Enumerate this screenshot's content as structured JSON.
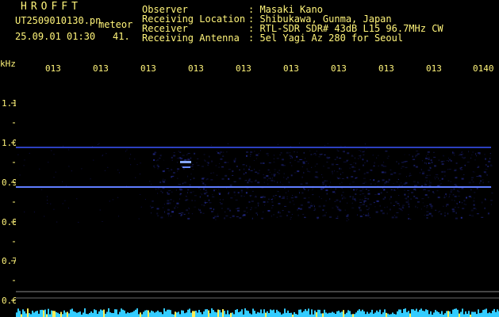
{
  "header": {
    "app_title": "HROFFT",
    "filename": "UT2509010130.pn",
    "tag": "meteor",
    "datetime": "25.09.01 01:30",
    "count": "41.",
    "fields": [
      {
        "label": "Observer",
        "value": ": Masaki Kano"
      },
      {
        "label": "Receiving Location",
        "value": ": Shibukawa, Gunma, Japan"
      },
      {
        "label": "Receiver",
        "value": ": RTL-SDR SDR# 43dB L15 96.7MHz CW"
      },
      {
        "label": "Receiving Antenna",
        "value": ": 5el Yagi Az 280 for Seoul"
      }
    ]
  },
  "axis": {
    "unit": "kHz",
    "y_ticks": [
      "1.1",
      "1.0",
      "0.9",
      "0.8",
      "0.7",
      "0.6"
    ],
    "x_ticks": [
      "013",
      "013",
      "013",
      "013",
      "013",
      "013",
      "013",
      "013",
      "013",
      "0140"
    ]
  },
  "colors": {
    "background": "#000000",
    "text": "#fff47a",
    "carrier": "#4f6bff",
    "noise": "#1a1aa0",
    "floor": "#33ddff"
  }
}
